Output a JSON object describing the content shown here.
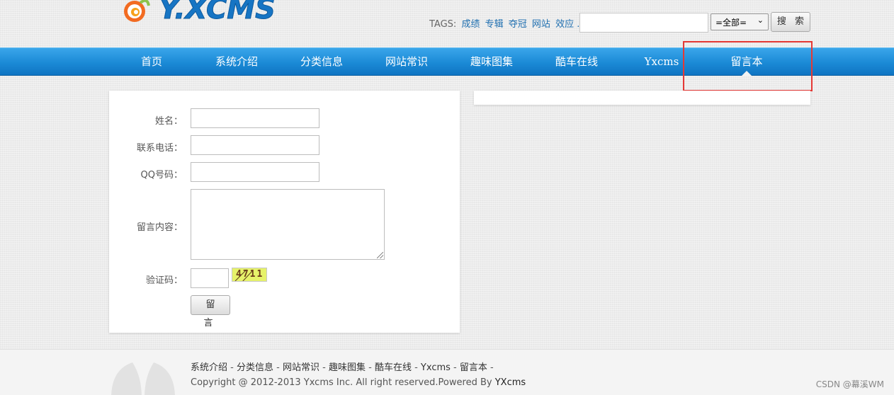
{
  "header": {
    "logo_text": "Y.XCMS",
    "tags_label": "TAGS:",
    "tags": [
      "成绩",
      "专辑",
      "夺冠",
      "网站",
      "效应 ..."
    ],
    "search_value": "",
    "scope_selected": "=全部=",
    "search_button": "搜 索"
  },
  "nav": {
    "items": [
      "首页",
      "系统介绍",
      "分类信息",
      "网站常识",
      "趣味图集",
      "酷车在线",
      "Yxcms",
      "留言本"
    ],
    "active": "留言本"
  },
  "form": {
    "name_label": "姓名：",
    "phone_label": "联系电话：",
    "qq_label": "QQ号码：",
    "content_label": "留言内容：",
    "captcha_label": "验证码：",
    "captcha_text": "4711",
    "submit_label": "留 言"
  },
  "footer": {
    "links": [
      "系统介绍",
      "分类信息",
      "网站常识",
      "趣味图集",
      "酷车在线",
      "Yxcms",
      "留言本"
    ],
    "copyright_prefix": "Copyright @ 2012-2013 Yxcms Inc. All right reserved.Powered By ",
    "copyright_brand": "YXcms",
    "watermark": "CSDN @幕溪WM"
  },
  "colors": {
    "nav_blue": "#1b8ad6",
    "highlight_red": "#e53935",
    "tag_link": "#1f6fb0"
  }
}
